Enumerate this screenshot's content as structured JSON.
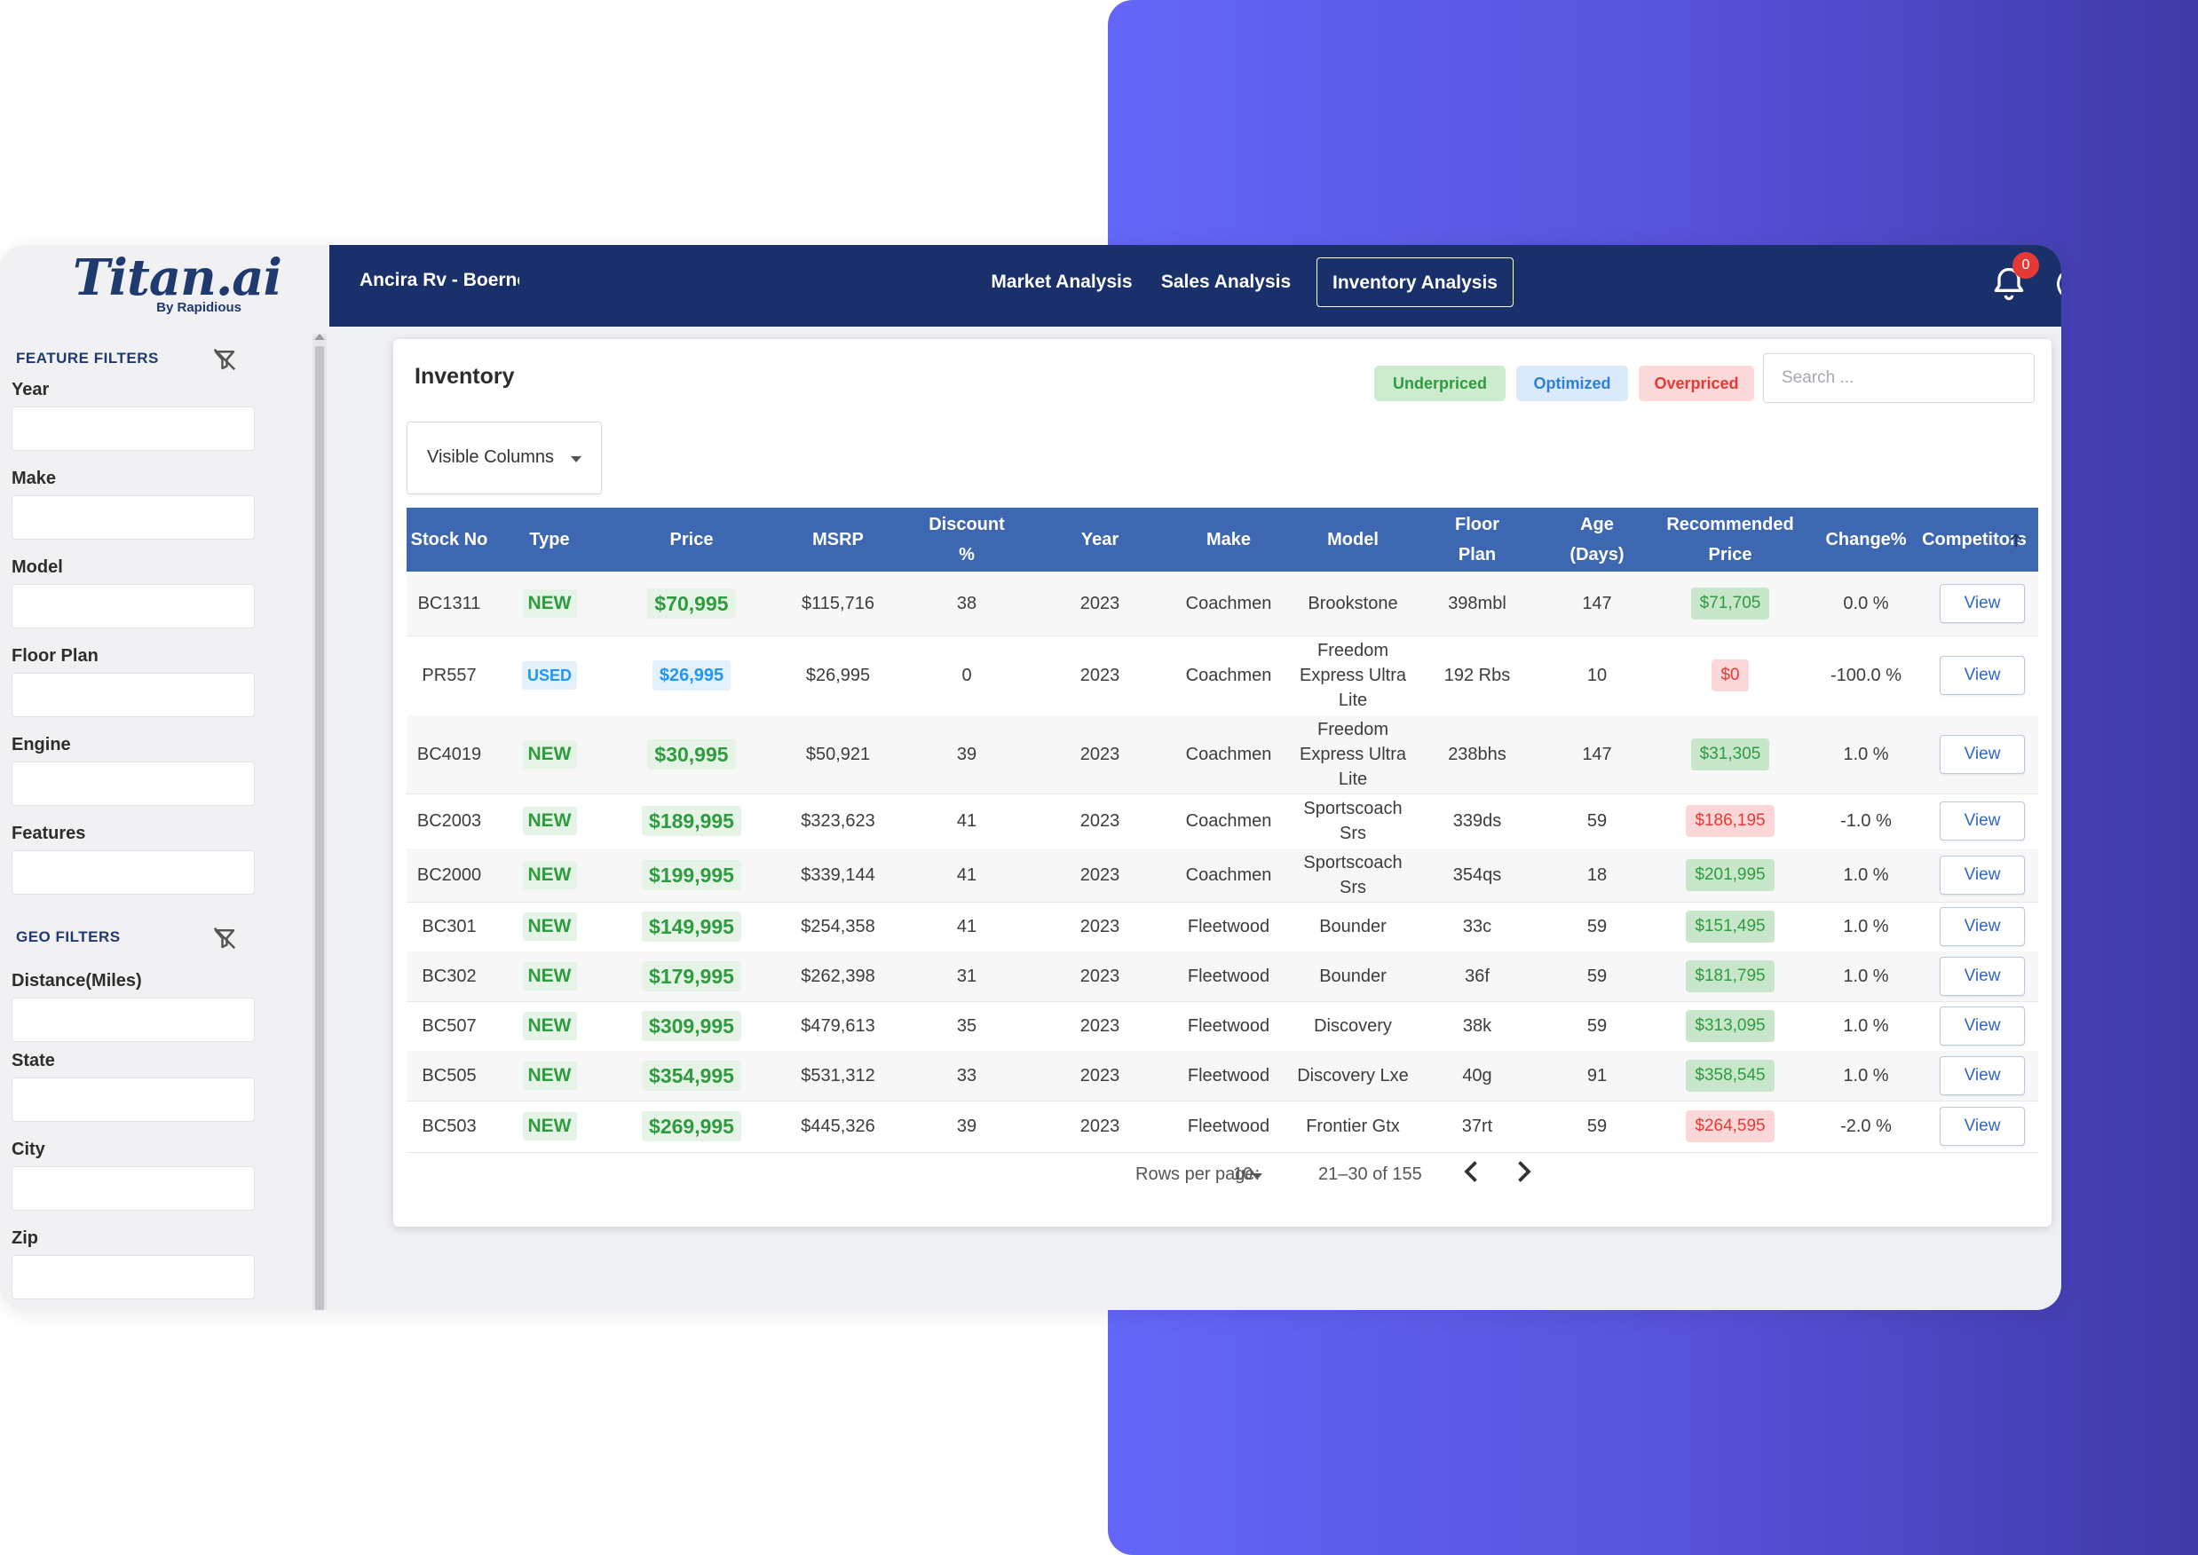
{
  "brand": {
    "logo": "Titan.ai",
    "logo_sub": "By Rapidious"
  },
  "colors": {
    "nav": "#19306a",
    "table_header": "#3d68b1",
    "underpriced": "#2e9b3e",
    "optimized": "#2196f3",
    "overpriced": "#e53935"
  },
  "sidebar": {
    "feature_filters_title": "FEATURE FILTERS",
    "geo_filters_title": "GEO FILTERS",
    "feature_filters": [
      "Year",
      "Make",
      "Model",
      "Floor Plan",
      "Engine",
      "Features"
    ],
    "geo_filters": [
      "Distance(Miles)",
      "State",
      "City",
      "Zip"
    ]
  },
  "topnav": {
    "dealer": "Ancira Rv - Boerne",
    "tabs": [
      "Market Analysis",
      "Sales Analysis",
      "Inventory Analysis"
    ],
    "active_tab": "Inventory Analysis",
    "notification_count": "0"
  },
  "inventory": {
    "title": "Inventory",
    "legend": {
      "underpriced": "Underpriced",
      "optimized": "Optimized",
      "overpriced": "Overpriced"
    },
    "search_placeholder": "Search ...",
    "visible_columns_label": "Visible Columns",
    "columns": [
      "Stock No",
      "Type",
      "Price",
      "MSRP",
      "Discount\n%",
      "Year",
      "Make",
      "Model",
      "Floor\nPlan",
      "Age\n(Days)",
      "Recommended\nPrice",
      "Change%",
      "Competitors"
    ],
    "rows": [
      {
        "stock": "BC1311",
        "type": "NEW",
        "price": "$70,995",
        "msrp": "$115,716",
        "discount": "38",
        "year": "2023",
        "make": "Coachmen",
        "model": "Brookstone",
        "floor_plan": "398mbl",
        "age": "147",
        "rec_price": "$71,705",
        "rec_status": "under",
        "change": "0.0 %",
        "action": "View"
      },
      {
        "stock": "PR557",
        "type": "USED",
        "price": "$26,995",
        "msrp": "$26,995",
        "discount": "0",
        "year": "2023",
        "make": "Coachmen",
        "model": "Freedom\nExpress Ultra\nLite",
        "floor_plan": "192 Rbs",
        "age": "10",
        "rec_price": "$0",
        "rec_status": "over",
        "change": "-100.0 %",
        "action": "View"
      },
      {
        "stock": "BC4019",
        "type": "NEW",
        "price": "$30,995",
        "msrp": "$50,921",
        "discount": "39",
        "year": "2023",
        "make": "Coachmen",
        "model": "Freedom\nExpress Ultra\nLite",
        "floor_plan": "238bhs",
        "age": "147",
        "rec_price": "$31,305",
        "rec_status": "under",
        "change": "1.0 %",
        "action": "View"
      },
      {
        "stock": "BC2003",
        "type": "NEW",
        "price": "$189,995",
        "msrp": "$323,623",
        "discount": "41",
        "year": "2023",
        "make": "Coachmen",
        "model": "Sportscoach\nSrs",
        "floor_plan": "339ds",
        "age": "59",
        "rec_price": "$186,195",
        "rec_status": "over",
        "change": "-1.0 %",
        "action": "View"
      },
      {
        "stock": "BC2000",
        "type": "NEW",
        "price": "$199,995",
        "msrp": "$339,144",
        "discount": "41",
        "year": "2023",
        "make": "Coachmen",
        "model": "Sportscoach\nSrs",
        "floor_plan": "354qs",
        "age": "18",
        "rec_price": "$201,995",
        "rec_status": "under",
        "change": "1.0 %",
        "action": "View"
      },
      {
        "stock": "BC301",
        "type": "NEW",
        "price": "$149,995",
        "msrp": "$254,358",
        "discount": "41",
        "year": "2023",
        "make": "Fleetwood",
        "model": "Bounder",
        "floor_plan": "33c",
        "age": "59",
        "rec_price": "$151,495",
        "rec_status": "under",
        "change": "1.0 %",
        "action": "View"
      },
      {
        "stock": "BC302",
        "type": "NEW",
        "price": "$179,995",
        "msrp": "$262,398",
        "discount": "31",
        "year": "2023",
        "make": "Fleetwood",
        "model": "Bounder",
        "floor_plan": "36f",
        "age": "59",
        "rec_price": "$181,795",
        "rec_status": "under",
        "change": "1.0 %",
        "action": "View"
      },
      {
        "stock": "BC507",
        "type": "NEW",
        "price": "$309,995",
        "msrp": "$479,613",
        "discount": "35",
        "year": "2023",
        "make": "Fleetwood",
        "model": "Discovery",
        "floor_plan": "38k",
        "age": "59",
        "rec_price": "$313,095",
        "rec_status": "under",
        "change": "1.0 %",
        "action": "View"
      },
      {
        "stock": "BC505",
        "type": "NEW",
        "price": "$354,995",
        "msrp": "$531,312",
        "discount": "33",
        "year": "2023",
        "make": "Fleetwood",
        "model": "Discovery Lxe",
        "floor_plan": "40g",
        "age": "91",
        "rec_price": "$358,545",
        "rec_status": "under",
        "change": "1.0 %",
        "action": "View"
      },
      {
        "stock": "BC503",
        "type": "NEW",
        "price": "$269,995",
        "msrp": "$445,326",
        "discount": "39",
        "year": "2023",
        "make": "Fleetwood",
        "model": "Frontier Gtx",
        "floor_plan": "37rt",
        "age": "59",
        "rec_price": "$264,595",
        "rec_status": "over",
        "change": "-2.0 %",
        "action": "View"
      }
    ],
    "pagination": {
      "rows_per_page_label": "Rows per page:",
      "rows_per_page": "10",
      "range": "21–30 of 155"
    }
  }
}
